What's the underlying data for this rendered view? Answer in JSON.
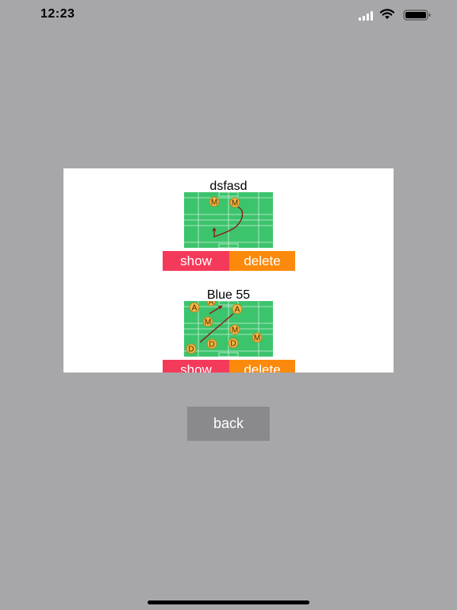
{
  "status_bar": {
    "time": "12:23"
  },
  "entries": [
    {
      "title": "dsfasd",
      "players": [
        "M",
        "M"
      ],
      "show_label": "show",
      "delete_label": "delete"
    },
    {
      "title": "Blue 55",
      "players": [
        "A",
        "A",
        "A",
        "M",
        "M",
        "M",
        "D",
        "D",
        "D",
        "M"
      ],
      "show_label": "show",
      "delete_label": "delete"
    }
  ],
  "back_label": "back",
  "colors": {
    "background": "#a7a6a9",
    "field": "#3cc46c",
    "show": "#f43a5b",
    "delete": "#fb8a0c",
    "back": "#8a898c",
    "player_token": "#f2b547",
    "play_line": "#8b1a1a"
  }
}
